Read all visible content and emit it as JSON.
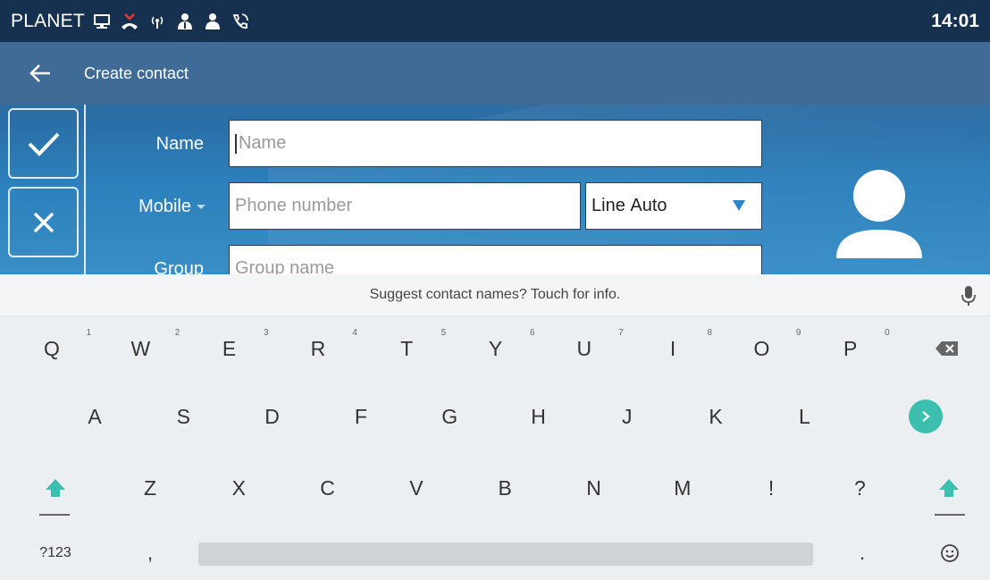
{
  "status_bar": {
    "brand": "PLANET",
    "clock": "14:01",
    "icons": [
      "network-icon",
      "missed-call-icon",
      "wireless-icon",
      "user-group-icon",
      "user-icon",
      "call-forward-icon"
    ]
  },
  "header": {
    "title": "Create contact",
    "back_icon": "arrow-left-icon"
  },
  "actions": {
    "confirm_icon": "check-icon",
    "cancel_icon": "close-icon"
  },
  "form": {
    "name_label": "Name",
    "name_placeholder": "Name",
    "mobile_label": "Mobile",
    "phone_placeholder": "Phone number",
    "line_label": "Line",
    "line_value": "Auto",
    "group_label": "Group",
    "group_placeholder": "Group name"
  },
  "avatar_icon": "person-icon",
  "keyboard": {
    "suggestion": "Suggest contact names? Touch for info.",
    "row1": [
      {
        "k": "Q",
        "h": "1"
      },
      {
        "k": "W",
        "h": "2"
      },
      {
        "k": "E",
        "h": "3"
      },
      {
        "k": "R",
        "h": "4"
      },
      {
        "k": "T",
        "h": "5"
      },
      {
        "k": "Y",
        "h": "6"
      },
      {
        "k": "U",
        "h": "7"
      },
      {
        "k": "I",
        "h": "8"
      },
      {
        "k": "O",
        "h": "9"
      },
      {
        "k": "P",
        "h": "0"
      }
    ],
    "row2": [
      "A",
      "S",
      "D",
      "F",
      "G",
      "H",
      "J",
      "K",
      "L"
    ],
    "row3": [
      "Z",
      "X",
      "C",
      "V",
      "B",
      "N",
      "M",
      "!",
      "?"
    ],
    "symbols_label": "?123",
    "comma": ",",
    "period": ".",
    "colors": {
      "accent": "#3cbfae",
      "status_bar": "#16304f",
      "header": "#3f6b96"
    }
  }
}
